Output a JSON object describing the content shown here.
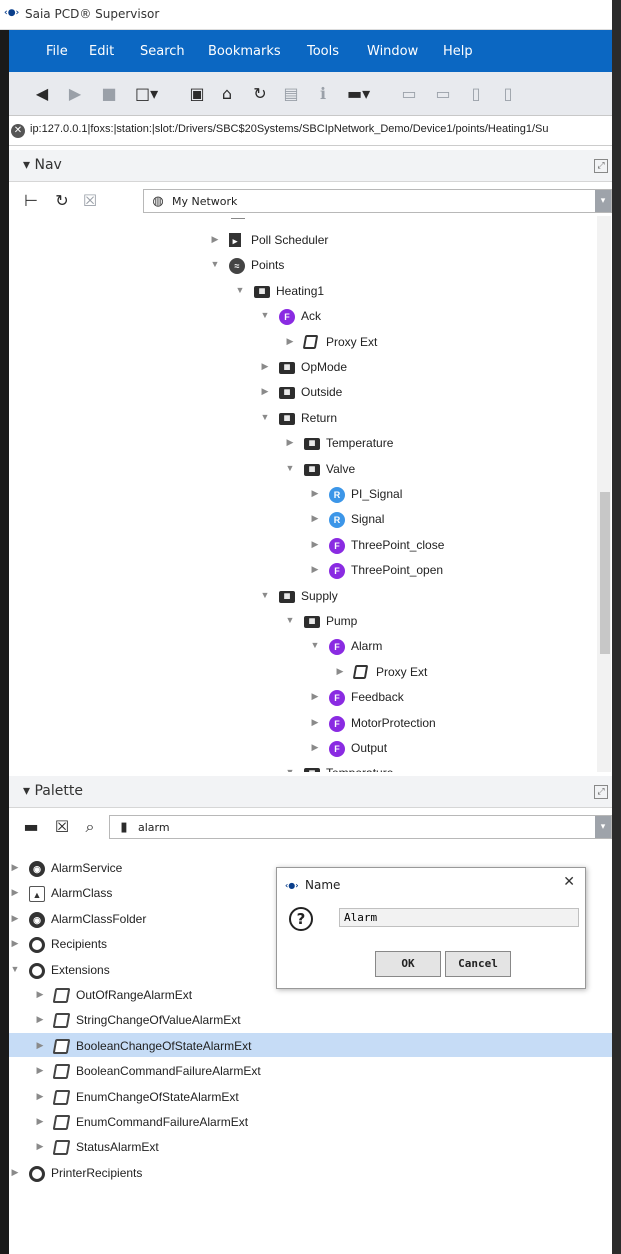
{
  "window": {
    "title": "Saia PCD® Supervisor",
    "logo_text": "‹●›"
  },
  "menu": [
    "File",
    "Edit",
    "Search",
    "Bookmarks",
    "Tools",
    "Window",
    "Help"
  ],
  "path": "ip:127.0.0.1|foxs:|station:|slot:/Drivers/SBC$20Systems/SBCIpNetwork_Demo/Device1/points/Heating1/Su",
  "nav": {
    "title": "Nav",
    "network": "My Network",
    "tree": [
      {
        "label": "Poll Scheduler",
        "icon": "sched",
        "expanded": false,
        "depth": 0
      },
      {
        "label": "Points",
        "icon": "points",
        "expanded": true,
        "depth": 0
      },
      {
        "label": "Heating1",
        "icon": "folder",
        "expanded": true,
        "depth": 1
      },
      {
        "label": "Ack",
        "icon": "F",
        "expanded": true,
        "depth": 2
      },
      {
        "label": "Proxy Ext",
        "icon": "proxy",
        "expanded": false,
        "depth": 3
      },
      {
        "label": "OpMode",
        "icon": "folder",
        "expanded": false,
        "depth": 2
      },
      {
        "label": "Outside",
        "icon": "folder",
        "expanded": false,
        "depth": 2
      },
      {
        "label": "Return",
        "icon": "folder",
        "expanded": true,
        "depth": 2
      },
      {
        "label": "Temperature",
        "icon": "folder",
        "expanded": false,
        "depth": 3
      },
      {
        "label": "Valve",
        "icon": "folder",
        "expanded": true,
        "depth": 3
      },
      {
        "label": "PI_Signal",
        "icon": "R",
        "expanded": false,
        "depth": 4
      },
      {
        "label": "Signal",
        "icon": "R",
        "expanded": false,
        "depth": 4
      },
      {
        "label": "ThreePoint_close",
        "icon": "F",
        "expanded": false,
        "depth": 4
      },
      {
        "label": "ThreePoint_open",
        "icon": "F",
        "expanded": false,
        "depth": 4
      },
      {
        "label": "Supply",
        "icon": "folder",
        "expanded": true,
        "depth": 2
      },
      {
        "label": "Pump",
        "icon": "folder",
        "expanded": true,
        "depth": 3
      },
      {
        "label": "Alarm",
        "icon": "F",
        "expanded": true,
        "depth": 4
      },
      {
        "label": "Proxy Ext",
        "icon": "proxy",
        "expanded": false,
        "depth": 5
      },
      {
        "label": "Feedback",
        "icon": "F",
        "expanded": false,
        "depth": 4
      },
      {
        "label": "MotorProtection",
        "icon": "F",
        "expanded": false,
        "depth": 4
      },
      {
        "label": "Output",
        "icon": "F",
        "expanded": false,
        "depth": 4
      },
      {
        "label": "Temperature",
        "icon": "folder",
        "expanded": true,
        "depth": 3
      }
    ]
  },
  "palette": {
    "title": "Palette",
    "module": "alarm",
    "tree": [
      {
        "label": "AlarmService",
        "icon": "svc",
        "expanded": false,
        "depth": 0
      },
      {
        "label": "AlarmClass",
        "icon": "cls",
        "expanded": false,
        "depth": 0
      },
      {
        "label": "AlarmClassFolder",
        "icon": "svc",
        "expanded": false,
        "depth": 0
      },
      {
        "label": "Recipients",
        "icon": "ring",
        "expanded": false,
        "depth": 0
      },
      {
        "label": "Extensions",
        "icon": "ring",
        "expanded": true,
        "depth": 0
      },
      {
        "label": "OutOfRangeAlarmExt",
        "icon": "ext",
        "expanded": false,
        "depth": 1
      },
      {
        "label": "StringChangeOfValueAlarmExt",
        "icon": "ext",
        "expanded": false,
        "depth": 1
      },
      {
        "label": "BooleanChangeOfStateAlarmExt",
        "icon": "ext",
        "expanded": false,
        "depth": 1,
        "selected": true
      },
      {
        "label": "BooleanCommandFailureAlarmExt",
        "icon": "ext",
        "expanded": false,
        "depth": 1
      },
      {
        "label": "EnumChangeOfStateAlarmExt",
        "icon": "ext",
        "expanded": false,
        "depth": 1
      },
      {
        "label": "EnumCommandFailureAlarmExt",
        "icon": "ext",
        "expanded": false,
        "depth": 1
      },
      {
        "label": "StatusAlarmExt",
        "icon": "ext",
        "expanded": false,
        "depth": 1
      },
      {
        "label": "PrinterRecipients",
        "icon": "ring",
        "expanded": false,
        "depth": 0
      }
    ]
  },
  "dialog": {
    "title": "Name",
    "value": "Alarm",
    "ok": "OK",
    "cancel": "Cancel"
  },
  "colors": {
    "menu_bg": "#0b67c2",
    "selection": "#c6dcf6",
    "func_icon": "#8a2be2",
    "real_icon": "#3c96e8"
  }
}
